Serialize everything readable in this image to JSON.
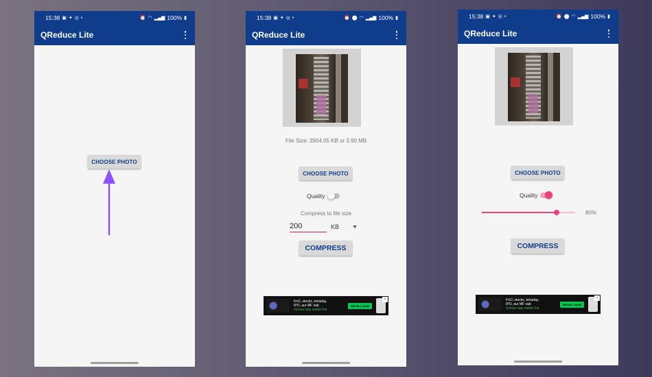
{
  "status_bar": {
    "time": "15:38",
    "battery": "100%",
    "left_icons": [
      "gallery-icon",
      "twitter-icon",
      "sync-icon",
      "dot-icon"
    ],
    "right_icons": [
      "alarm-icon",
      "location-icon",
      "wifi-icon",
      "volte-icon",
      "signal-icon",
      "battery-icon"
    ]
  },
  "app": {
    "title": "QReduce Lite",
    "header_color": "#0f3d8c",
    "accent_color": "#ec407a"
  },
  "screen1": {
    "choose_photo_label": "CHOOSE PHOTO"
  },
  "screen2": {
    "file_size_text": "File Size: 3904.05 KB or 3.90 MB",
    "choose_photo_label": "CHOOSE PHOTO",
    "quality_label": "Quality",
    "quality_toggle_on": false,
    "compress_to_label": "Compress to file size",
    "size_value": "200",
    "size_unit": "KB",
    "compress_label": "COMPRESS"
  },
  "screen3": {
    "choose_photo_label": "CHOOSE PHOTO",
    "quality_label": "Quality",
    "quality_toggle_on": true,
    "quality_percent": "80%",
    "quality_value": 0.8,
    "compress_label": "COMPRESS"
  },
  "ad": {
    "line1": "FnO, stocks, intraday,",
    "line2": "IPO, aur MF sab",
    "line3": "Groww app sabke hai",
    "cta": "INSTALL NOW"
  },
  "annotation_color": "#8c52ff"
}
